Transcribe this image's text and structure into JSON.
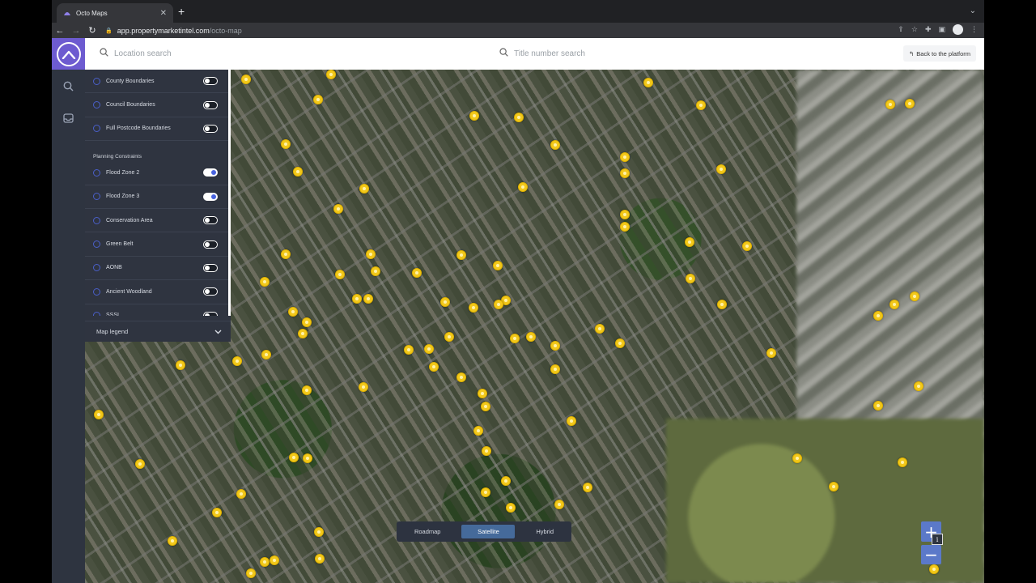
{
  "browser": {
    "tab_title": "Octo Maps",
    "url_domain": "app.propertymarketintel.com",
    "url_path": "/octo-map"
  },
  "topbar": {
    "location_placeholder": "Location search",
    "title_placeholder": "Title number search",
    "back_label": "Back to the platform"
  },
  "layers": {
    "boundaries": [
      {
        "label": "County Boundaries",
        "on": false
      },
      {
        "label": "Council Boundaries",
        "on": false
      },
      {
        "label": "Full Postcode Boundaries",
        "on": false
      }
    ],
    "planning_heading": "Planning Constraints",
    "planning": [
      {
        "label": "Flood Zone 2",
        "on": true
      },
      {
        "label": "Flood Zone 3",
        "on": true
      },
      {
        "label": "Conservation Area",
        "on": false
      },
      {
        "label": "Green Belt",
        "on": false
      },
      {
        "label": "AONB",
        "on": false
      },
      {
        "label": "Ancient Woodland",
        "on": false
      },
      {
        "label": "SSSI",
        "on": false
      }
    ],
    "legend_label": "Map legend"
  },
  "map_types": [
    {
      "label": "Roadmap",
      "active": false
    },
    {
      "label": "Satellite",
      "active": true
    },
    {
      "label": "Hybrid",
      "active": false
    }
  ],
  "icons": {
    "brand": "octo-logo-icon",
    "rail": [
      "search-icon",
      "inbox-icon"
    ],
    "zoom_in": "+",
    "zoom_out": "−",
    "info": "i"
  },
  "colors": {
    "brand": "#6d5bd0",
    "marker": "#f2c81b",
    "toggle_on": "#4863e0",
    "active_map_type": "#456a9a",
    "zoom_button": "#5b79c9"
  }
}
